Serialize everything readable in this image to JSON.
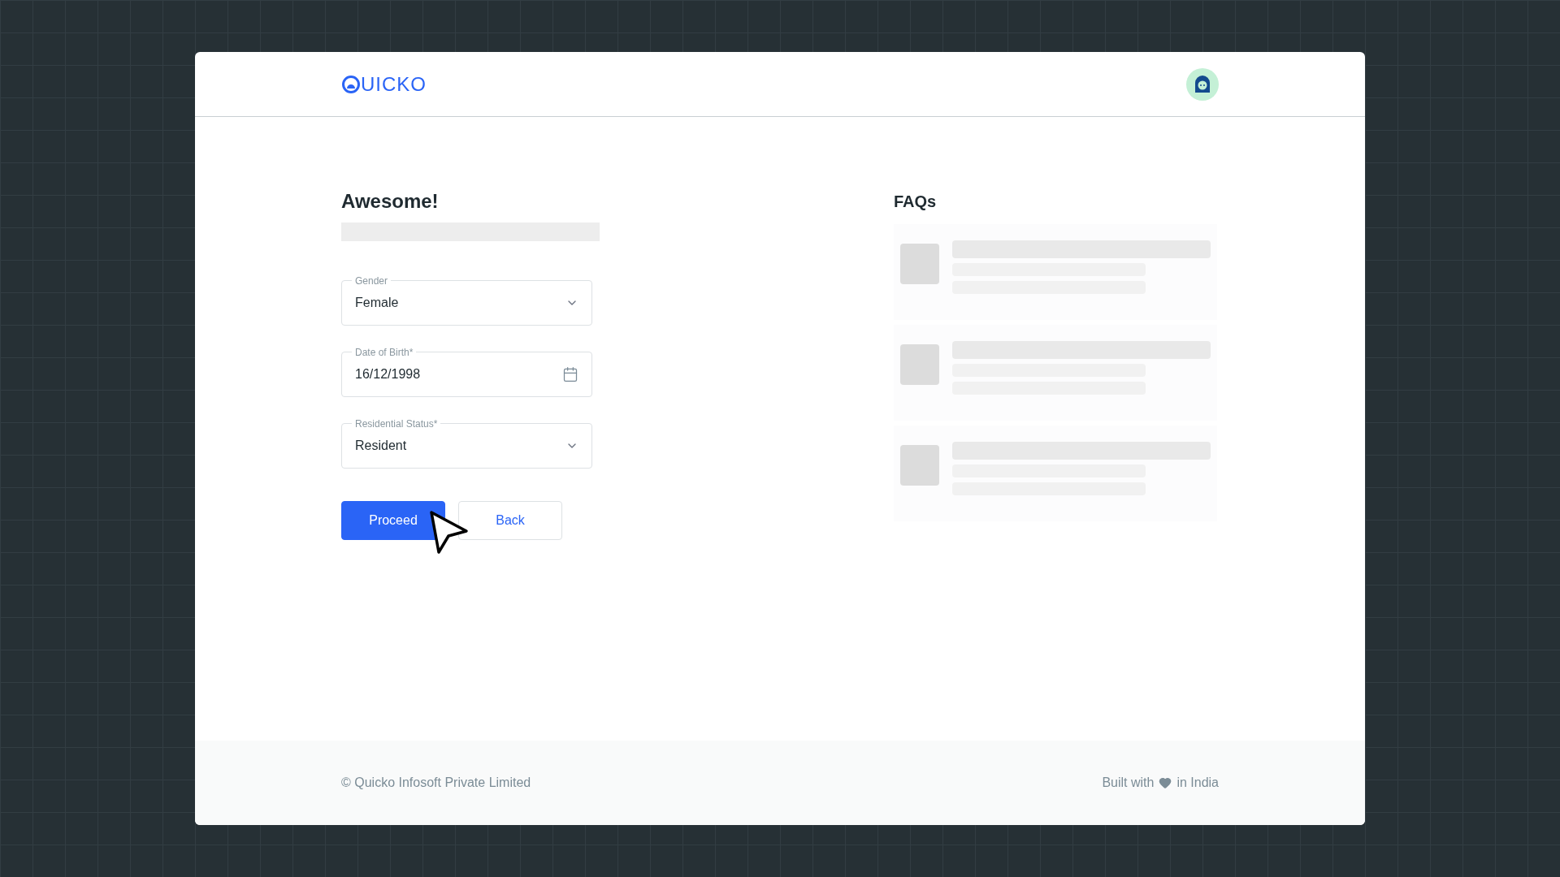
{
  "header": {
    "logo_text": "UICKO"
  },
  "form": {
    "title": "Awesome!",
    "fields": [
      {
        "kind": "select",
        "label": "Gender",
        "value": "Female"
      },
      {
        "kind": "date",
        "label": "Date of Birth*",
        "value": "16/12/1998"
      },
      {
        "kind": "select",
        "label": "Residential Status*",
        "value": "Resident"
      }
    ],
    "buttons": [
      {
        "kind": "primary",
        "label": "Proceed"
      },
      {
        "kind": "secondary",
        "label": "Back"
      }
    ]
  },
  "faqs": {
    "title": "FAQs"
  },
  "footer": {
    "copyright": "© Quicko Infosoft Private Limited",
    "built_with": "Built with",
    "location": "in India"
  }
}
